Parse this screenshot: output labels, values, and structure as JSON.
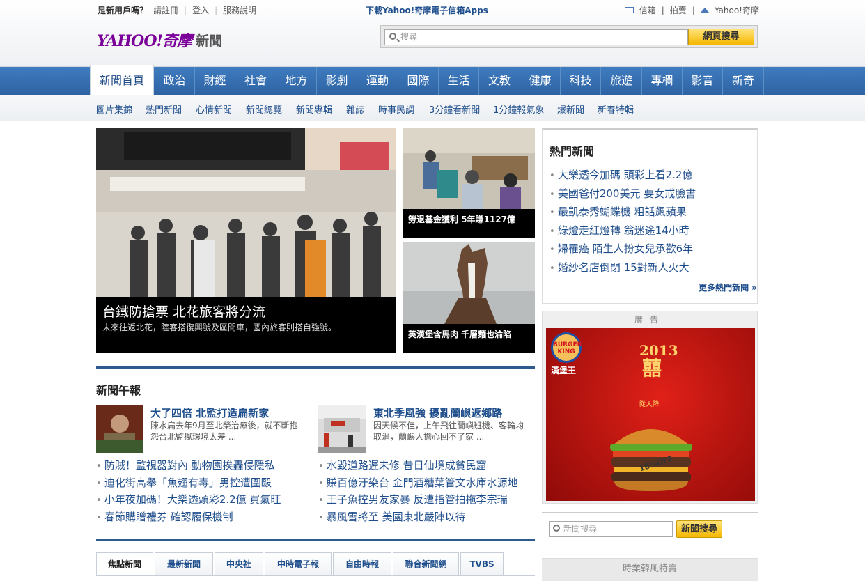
{
  "utility": {
    "new_user": "是新用戶嗎？",
    "register": "請註冊",
    "login": "登入",
    "help": "服務說明",
    "app_promo": "下載Yahoo!奇摩電子信箱Apps",
    "mail": "信箱",
    "auction": "拍賣",
    "home": "Yahoo!奇摩"
  },
  "logo": {
    "brand": "YAHOO!奇摩",
    "section": "新聞"
  },
  "search": {
    "placeholder": "搜尋",
    "button": "網頁搜尋"
  },
  "nav": {
    "tabs": [
      "新聞首頁",
      "政治",
      "財經",
      "社會",
      "地方",
      "影劇",
      "運動",
      "國際",
      "生活",
      "文教",
      "健康",
      "科技",
      "旅遊",
      "專欄",
      "影音",
      "新奇"
    ],
    "active": "新聞首頁"
  },
  "subnav": {
    "items": [
      "圖片集錦",
      "熱門新聞",
      "心情新聞",
      "新聞總覽",
      "新聞專輯",
      "雜誌",
      "時事民調",
      "3分鐘看新聞",
      "1分鐘報氣象",
      "爆新聞",
      "新春特輯"
    ]
  },
  "hero": {
    "title": "台鐵防搶票 北花旅客將分流",
    "desc": "未來往返北花，陸客搭復興號及區間車，國內旅客則搭自強號。"
  },
  "side_photos": [
    {
      "caption": "勞退基金獲利 5年賺1127億"
    },
    {
      "caption": "英漢堡含馬肉 千層麵也淪陷"
    }
  ],
  "hot_news": {
    "title": "熱門新聞",
    "items": [
      "大樂透今加碼 頭彩上看2.2億",
      "美國爸付200美元 要女戒臉書",
      "最凱泰秀蝴蝶機 粗話飆蘋果",
      "綠燈走紅燈轉 翁迷途14小時",
      "婦罹癌 陌生人扮女兒承歡6年",
      "婚紗名店倒閉 15對新人火大"
    ],
    "more": "更多熱門新聞 »"
  },
  "ad": {
    "label": "廣告",
    "brand_badge": "BURGER KING",
    "brand_name": "漢堡王",
    "year": "2013",
    "headline": "囍",
    "tagline": "從天降",
    "burger_text": "18%OFF"
  },
  "noon_news": {
    "title": "新聞午報",
    "features": [
      {
        "title": "大了四倍 北監打造扁新家",
        "desc": "陳水扁去年9月至北榮治療後，就不斷抱怨台北監獄環境太差 ..."
      },
      {
        "title": "東北季風強 擾亂蘭嶼返鄉路",
        "desc": "因天候不佳，上午飛往蘭嶼班機、客輪均取消，蘭嶼人擔心回不了家 ..."
      }
    ],
    "left_list": [
      "防賊！監視器對內 動物園挨轟侵隱私",
      "迪化街高舉「魚翅有毒」男控遭圍毆",
      "小年夜加碼！大樂透頭彩2.2億 買氣旺",
      "春節購贈禮券 確認履保機制"
    ],
    "right_list": [
      "水毀道路遲未修 昔日仙境成貧民窟",
      "賺百億汙染台 金門酒糟葉管文水庫水源地",
      "王子魚控男友家暴 反遭指管拍拖李宗瑞",
      "暴風雪將至 美國東北嚴陣以待"
    ]
  },
  "source_tabs": [
    "焦點新聞",
    "最新新聞",
    "中央社",
    "中時電子報",
    "自由時報",
    "聯合新聞網",
    "TVBS"
  ],
  "news_search": {
    "placeholder": "新聞搜尋",
    "button": "新聞搜尋"
  },
  "promo": {
    "text": "時業韓風特賣"
  }
}
